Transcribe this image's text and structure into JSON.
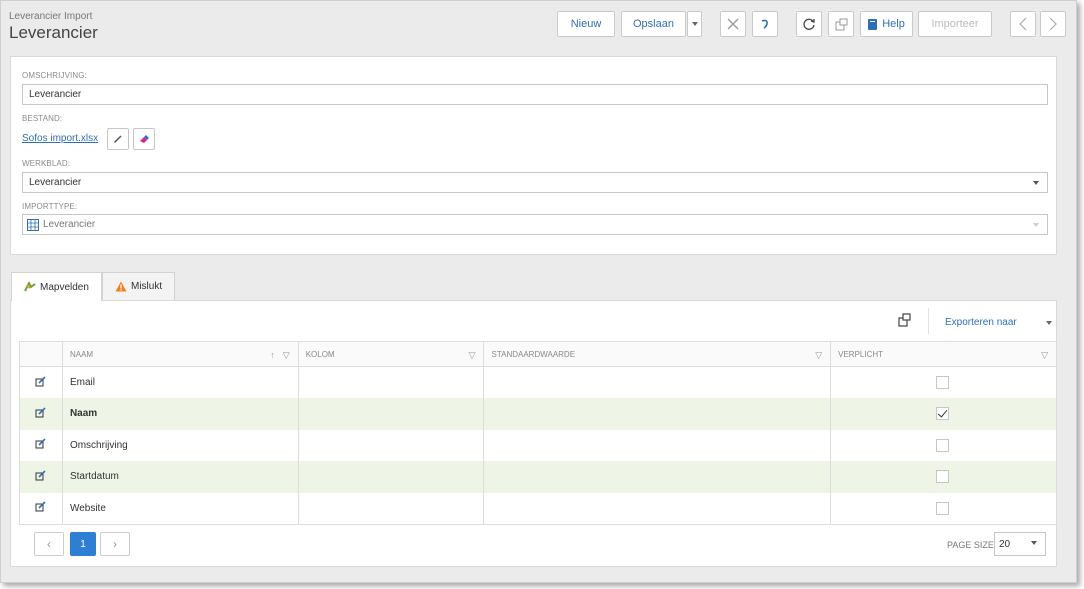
{
  "header": {
    "subtitle": "Leverancier Import",
    "title": "Leverancier"
  },
  "toolbar": {
    "new_label": "Nieuw",
    "save_label": "Opslaan",
    "help_label": "Help",
    "import_label": "Importeer"
  },
  "form": {
    "omschrijving_label": "OMSCHRIJVING:",
    "omschrijving_value": "Leverancier",
    "bestand_label": "BESTAND:",
    "bestand_file": "Sofos import.xlsx",
    "werkblad_label": "WERKBLAD:",
    "werkblad_value": "Leverancier",
    "importtype_label": "IMPORTTYPE:",
    "importtype_value": "Leverancier"
  },
  "tabs": [
    {
      "label": "Mapvelden"
    },
    {
      "label": "Mislukt"
    }
  ],
  "grid": {
    "export_label": "Exporteren naar",
    "columns": [
      "NAAM",
      "KOLOM",
      "STANDAARDWAARDE",
      "VERPLICHT"
    ],
    "rows": [
      {
        "naam": "Email",
        "kolom": "",
        "standaard": "",
        "verplicht": false
      },
      {
        "naam": "Naam",
        "kolom": "",
        "standaard": "",
        "verplicht": true
      },
      {
        "naam": "Omschrijving",
        "kolom": "",
        "standaard": "",
        "verplicht": false
      },
      {
        "naam": "Startdatum",
        "kolom": "",
        "standaard": "",
        "verplicht": false
      },
      {
        "naam": "Website",
        "kolom": "",
        "standaard": "",
        "verplicht": false
      }
    ]
  },
  "pager": {
    "current_page": "1",
    "page_size_label": "PAGE SIZE",
    "page_size_value": "20"
  },
  "colors": {
    "accent": "#2d7fd3",
    "link": "#2f6fb7",
    "required_name": "#d0021b",
    "alt_row": "#eef5e6"
  }
}
